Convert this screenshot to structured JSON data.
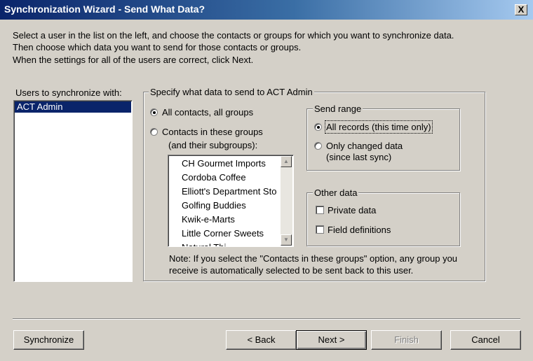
{
  "window": {
    "title": "Synchronization Wizard - Send What Data?",
    "close_label": "X"
  },
  "instructions": [
    "Select a user in the list on the left, and choose the contacts or groups for which you want to synchronize data.",
    "Then choose which data you want to send for those contacts or groups.",
    "When the settings for all of the users are correct, click Next."
  ],
  "users": {
    "label": "Users to synchronize with:",
    "items": [
      "ACT Admin"
    ],
    "selected": "ACT Admin"
  },
  "specify": {
    "label": "Specify what data to send to ACT Admin",
    "all_contacts_label": "All contacts, all groups",
    "contacts_in_groups_label": "Contacts in these groups",
    "subgroups_label": "(and their subgroups):",
    "selected_option": "All contacts, all groups",
    "groups": [
      "CH Gourmet Imports",
      "Cordoba Coffee",
      "Elliott's Department Sto",
      "Golfing Buddies",
      "Kwik-e-Marts",
      "Little Corner Sweets",
      "Natural Thi"
    ],
    "note_line1": "Note: If you select the \"Contacts in these groups\" option, any group you",
    "note_line2": "receive is automatically selected to be sent back to this user."
  },
  "send_range": {
    "label": "Send range",
    "all_records_label": "All records (this time only)",
    "only_changed_label": "Only changed data",
    "since_last_sync_label": "(since last sync)",
    "selected_option": "All records (this time only)"
  },
  "other_data": {
    "label": "Other data",
    "private_label": "Private data",
    "private_checked": false,
    "field_defs_label": "Field definitions",
    "field_defs_checked": false
  },
  "buttons": {
    "synchronize": "Synchronize",
    "back": "< Back",
    "next": "Next >",
    "finish": "Finish",
    "cancel": "Cancel"
  }
}
